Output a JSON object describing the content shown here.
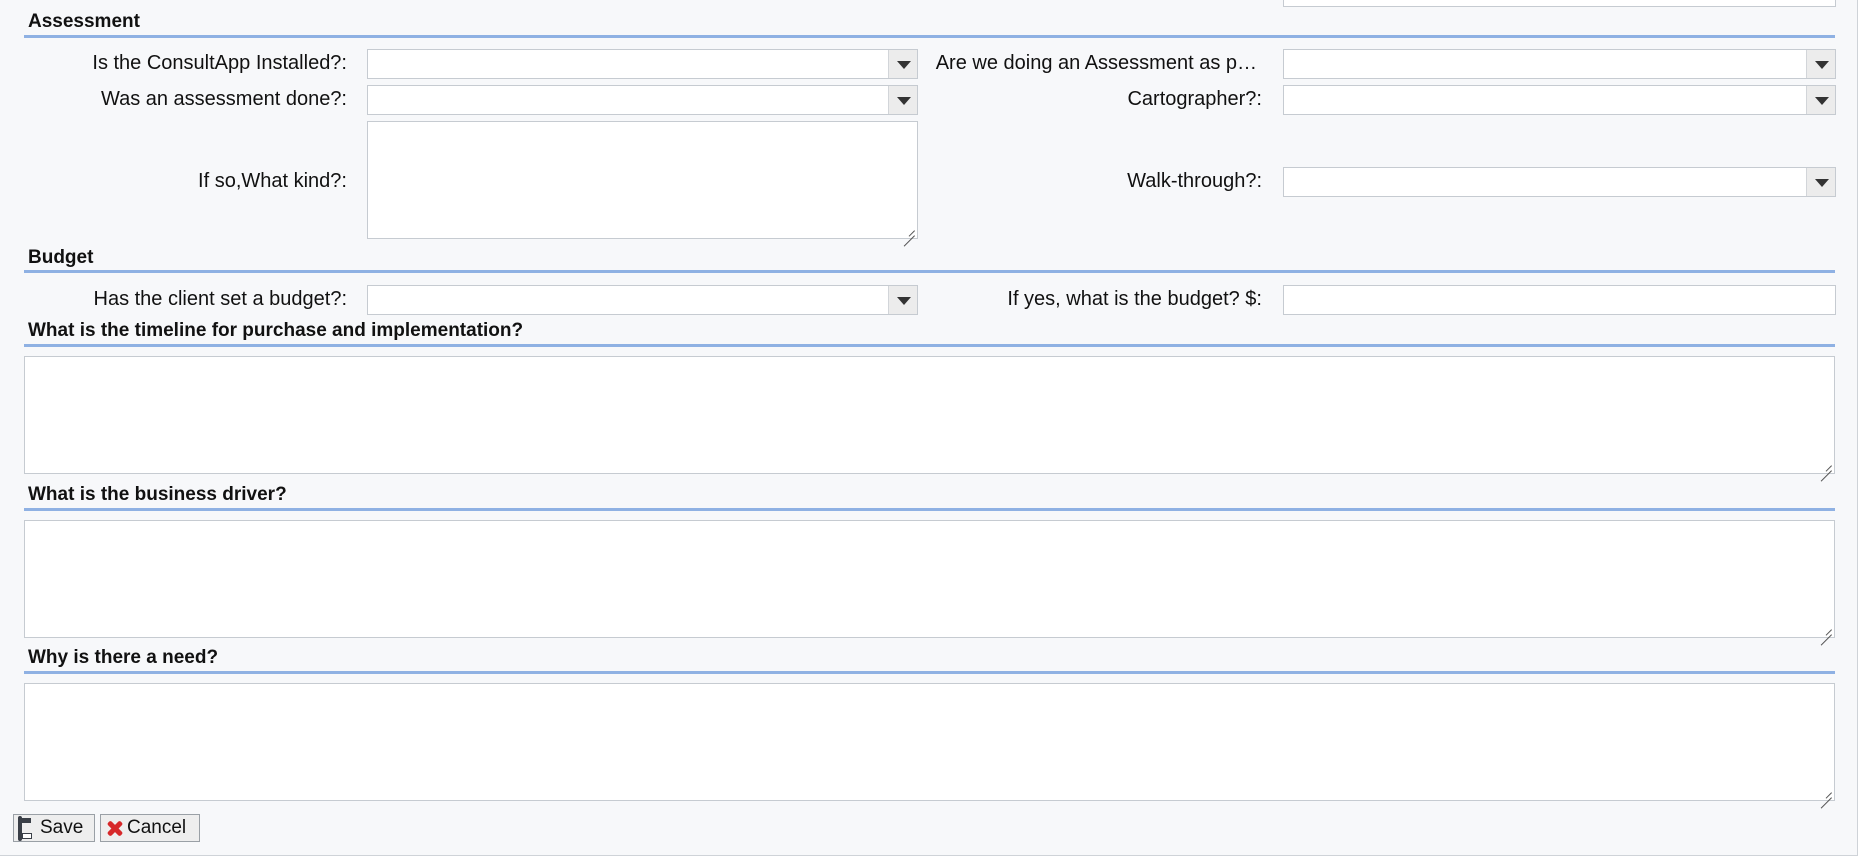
{
  "sections": {
    "assessment": "Assessment",
    "budget": "Budget",
    "timeline": "What is the timeline for purchase and implementation?",
    "driver": "What is the business driver?",
    "need": "Why is there a need?"
  },
  "fields": {
    "consultapp_installed": {
      "label": "Is the ConsultApp Installed?:",
      "value": ""
    },
    "doing_assessment": {
      "label": "Are we doing an Assessment as p…",
      "value": ""
    },
    "assessment_done": {
      "label": "Was an assessment done?:",
      "value": ""
    },
    "cartographer": {
      "label": "Cartographer?:",
      "value": ""
    },
    "what_kind": {
      "label": "If so,What kind?:",
      "value": ""
    },
    "walkthrough": {
      "label": "Walk-through?:",
      "value": ""
    },
    "budget_set": {
      "label": "Has the client set a budget?:",
      "value": ""
    },
    "budget_amount": {
      "label": "If yes, what is the budget? $:",
      "value": ""
    },
    "timeline_text": {
      "value": ""
    },
    "driver_text": {
      "value": ""
    },
    "need_text": {
      "value": ""
    }
  },
  "buttons": {
    "save": "Save",
    "cancel": "Cancel"
  },
  "icons": {
    "save": "floppy-disk-icon",
    "cancel": "red-x-icon"
  },
  "colors": {
    "section_rule": "#8fb1e3",
    "cancel_icon": "#d7282a"
  }
}
